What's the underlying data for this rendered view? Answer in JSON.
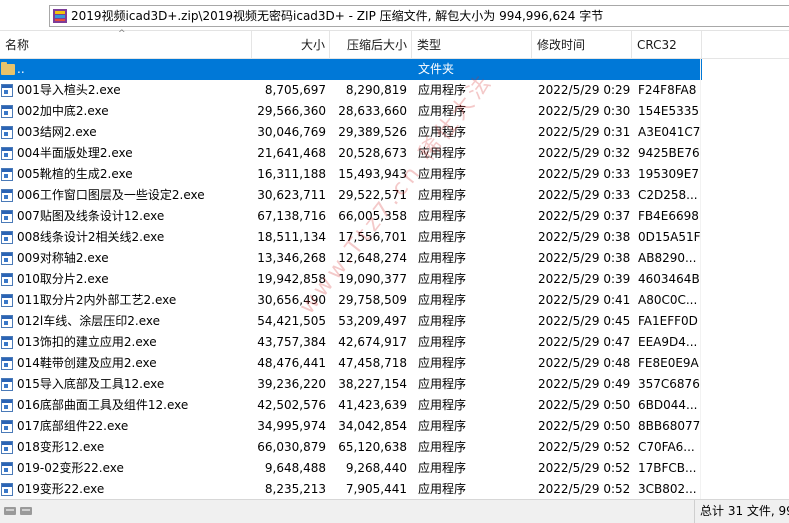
{
  "address_bar": {
    "path": "2019视频icad3D+.zip\\2019视频无密码icad3D+ - ZIP 压缩文件, 解包大小为 994,996,624 字节"
  },
  "columns": {
    "name": "名称",
    "size": "大小",
    "packed": "压缩后大小",
    "type": "类型",
    "modified": "修改时间",
    "crc": "CRC32"
  },
  "parent_row": {
    "name": "..",
    "type": "文件夹"
  },
  "files": [
    {
      "name": "001导入楦头2.exe",
      "size": "8,705,697",
      "packed": "8,290,819",
      "type": "应用程序",
      "modified": "2022/5/29 0:29",
      "crc": "F24F8FA8"
    },
    {
      "name": "002加中底2.exe",
      "size": "29,566,360",
      "packed": "28,633,660",
      "type": "应用程序",
      "modified": "2022/5/29 0:30",
      "crc": "154E5335"
    },
    {
      "name": "003结网2.exe",
      "size": "30,046,769",
      "packed": "29,389,526",
      "type": "应用程序",
      "modified": "2022/5/29 0:31",
      "crc": "A3E041C7"
    },
    {
      "name": "004半面版处理2.exe",
      "size": "21,641,468",
      "packed": "20,528,673",
      "type": "应用程序",
      "modified": "2022/5/29 0:32",
      "crc": "9425BE76"
    },
    {
      "name": "005靴楦的生成2.exe",
      "size": "16,311,188",
      "packed": "15,493,943",
      "type": "应用程序",
      "modified": "2022/5/29 0:33",
      "crc": "195309E7"
    },
    {
      "name": "006工作窗口图层及一些设定2.exe",
      "size": "30,623,711",
      "packed": "29,522,571",
      "type": "应用程序",
      "modified": "2022/5/29 0:33",
      "crc": "C2D258..."
    },
    {
      "name": "007贴图及线条设计12.exe",
      "size": "67,138,716",
      "packed": "66,005,358",
      "type": "应用程序",
      "modified": "2022/5/29 0:37",
      "crc": "FB4E6698"
    },
    {
      "name": "008线条设计2相关线2.exe",
      "size": "18,511,134",
      "packed": "17,556,701",
      "type": "应用程序",
      "modified": "2022/5/29 0:38",
      "crc": "0D15A51F"
    },
    {
      "name": "009对称轴2.exe",
      "size": "13,346,268",
      "packed": "12,648,274",
      "type": "应用程序",
      "modified": "2022/5/29 0:38",
      "crc": "AB8290..."
    },
    {
      "name": "010取分片2.exe",
      "size": "19,942,858",
      "packed": "19,090,377",
      "type": "应用程序",
      "modified": "2022/5/29 0:39",
      "crc": "4603464B"
    },
    {
      "name": "011取分片2内外部工艺2.exe",
      "size": "30,656,490",
      "packed": "29,758,509",
      "type": "应用程序",
      "modified": "2022/5/29 0:41",
      "crc": "A80C0C..."
    },
    {
      "name": "012l车线、涂层压印2.exe",
      "size": "54,421,505",
      "packed": "53,209,497",
      "type": "应用程序",
      "modified": "2022/5/29 0:45",
      "crc": "FA1EFF0D"
    },
    {
      "name": "013饰扣的建立应用2.exe",
      "size": "43,757,384",
      "packed": "42,674,917",
      "type": "应用程序",
      "modified": "2022/5/29 0:47",
      "crc": "EEA9D4..."
    },
    {
      "name": "014鞋带创建及应用2.exe",
      "size": "48,476,441",
      "packed": "47,458,718",
      "type": "应用程序",
      "modified": "2022/5/29 0:48",
      "crc": "FE8E0E9A"
    },
    {
      "name": "015导入底部及工具12.exe",
      "size": "39,236,220",
      "packed": "38,227,154",
      "type": "应用程序",
      "modified": "2022/5/29 0:49",
      "crc": "357C6876"
    },
    {
      "name": "016底部曲面工具及组件12.exe",
      "size": "42,502,576",
      "packed": "41,423,639",
      "type": "应用程序",
      "modified": "2022/5/29 0:50",
      "crc": "6BD044..."
    },
    {
      "name": "017底部组件22.exe",
      "size": "34,995,974",
      "packed": "34,042,854",
      "type": "应用程序",
      "modified": "2022/5/29 0:50",
      "crc": "8BB68077"
    },
    {
      "name": "018变形12.exe",
      "size": "66,030,879",
      "packed": "65,120,638",
      "type": "应用程序",
      "modified": "2022/5/29 0:52",
      "crc": "C70FA6..."
    },
    {
      "name": "019-02变形22.exe",
      "size": "9,648,488",
      "packed": "9,268,440",
      "type": "应用程序",
      "modified": "2022/5/29 0:52",
      "crc": "17BFCB..."
    },
    {
      "name": "019变形22.exe",
      "size": "8,235,213",
      "packed": "7,905,441",
      "type": "应用程序",
      "modified": "2022/5/29 0:52",
      "crc": "3CB802..."
    }
  ],
  "status_bar": {
    "summary": "总计 31 文件, 99"
  },
  "watermark": "www.Ttz7.cn 稀仕大法"
}
